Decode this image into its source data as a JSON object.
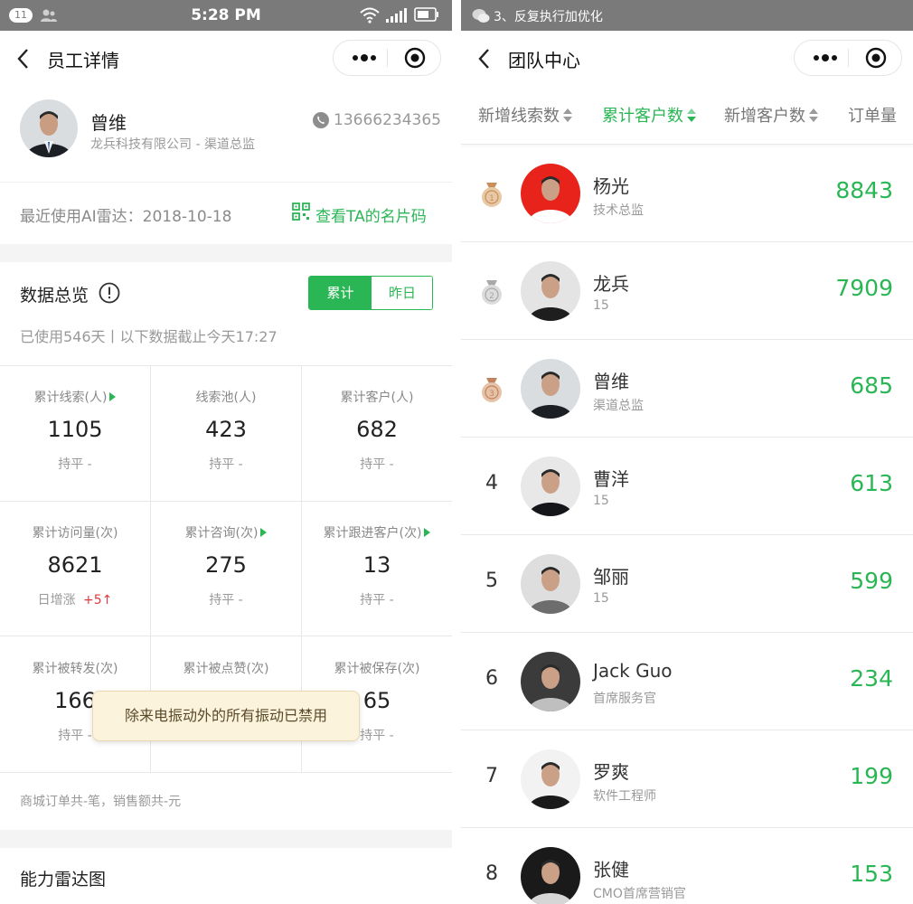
{
  "left": {
    "status": {
      "badge": "11",
      "time": "5:28 PM"
    },
    "nav": {
      "title": "员工详情"
    },
    "profile": {
      "name": "曾维",
      "company": "龙兵科技有限公司 - 渠道总监",
      "phone": "13666234365"
    },
    "radar": {
      "last_used": "最近使用AI雷达：2018-10-18",
      "card_link": "查看TA的名片码"
    },
    "overview": {
      "title": "数据总览",
      "toggle": [
        "累计",
        "昨日"
      ],
      "active_toggle": 0,
      "note": "已使用546天丨以下数据截止今天17:27"
    },
    "stats": [
      {
        "label": "累计线索(人)",
        "value": "1105",
        "sub": "持平 -",
        "arrow": true
      },
      {
        "label": "线索池(人)",
        "value": "423",
        "sub": "持平 -",
        "arrow": false
      },
      {
        "label": "累计客户(人)",
        "value": "682",
        "sub": "持平 -",
        "arrow": false
      },
      {
        "label": "累计访问量(次)",
        "value": "8621",
        "sub": "日增涨",
        "delta": "+5↑",
        "arrow": false
      },
      {
        "label": "累计咨询(次)",
        "value": "275",
        "sub": "持平 -",
        "arrow": true
      },
      {
        "label": "累计跟进客户(次)",
        "value": "13",
        "sub": "持平 -",
        "arrow": true
      },
      {
        "label": "累计被转发(次)",
        "value": "166",
        "sub": "持平 -",
        "arrow": false
      },
      {
        "label": "累计被点赞(次)",
        "value": "",
        "sub": "",
        "arrow": false
      },
      {
        "label": "累计被保存(次)",
        "value": "65",
        "sub": "持平 -",
        "arrow": false
      }
    ],
    "toast": "除来电振动外的所有振动已禁用",
    "mall": "商城订单共-笔，销售额共-元",
    "radar_chart_title": "能力雷达图"
  },
  "right": {
    "status": {
      "text": "3、反复执行加优化"
    },
    "nav": {
      "title": "团队中心"
    },
    "sort_tabs": [
      "新增线索数",
      "累计客户数",
      "新增客户数",
      "订单量"
    ],
    "active_sort": 1,
    "ranking": [
      {
        "rank": "1",
        "name": "杨光",
        "sub": "技术总监",
        "value": "8843",
        "medal": "gold"
      },
      {
        "rank": "2",
        "name": "龙兵",
        "sub": "15",
        "value": "7909",
        "medal": "silver"
      },
      {
        "rank": "3",
        "name": "曾维",
        "sub": "渠道总监",
        "value": "685",
        "medal": "bronze"
      },
      {
        "rank": "4",
        "name": "曹洋",
        "sub": "15",
        "value": "613"
      },
      {
        "rank": "5",
        "name": "邹丽",
        "sub": "15",
        "value": "599"
      },
      {
        "rank": "6",
        "name": "Jack Guo",
        "sub": "首席服务官",
        "value": "234"
      },
      {
        "rank": "7",
        "name": "罗爽",
        "sub": "软件工程师",
        "value": "199"
      },
      {
        "rank": "8",
        "name": "张健",
        "sub": "CMO首席营销官",
        "value": "153"
      }
    ]
  },
  "colors": {
    "accent": "#2bb655",
    "statusbar": "#7a7a7a",
    "up": "#e4393c",
    "toast_bg": "#fcf3dc"
  }
}
